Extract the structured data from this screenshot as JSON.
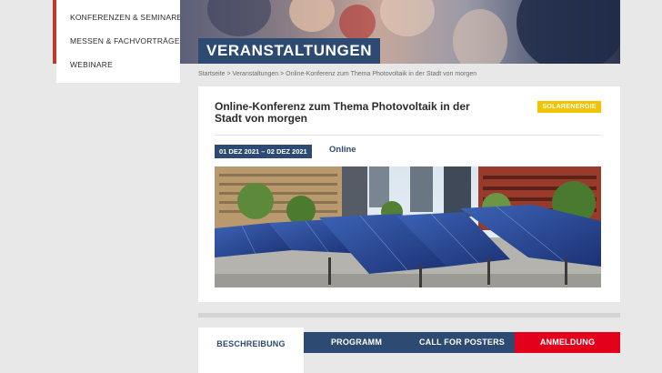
{
  "sidebar": {
    "items": [
      {
        "label": "KONFERENZEN & SEMINARE"
      },
      {
        "label": "MESSEN & FACHVORTRÄGE"
      },
      {
        "label": "WEBINARE"
      }
    ]
  },
  "hero": {
    "title": "VERANSTALTUNGEN"
  },
  "breadcrumb": "Startseite > Veranstaltungen > Online-Konferenz zum Thema Photovoltaik in der Stadt von morgen",
  "event": {
    "title": "Online-Konferenz zum Thema Photovoltaik in der Stadt von morgen",
    "tag": "SOLARENERGIE",
    "date": "01 DEZ 2021 – 02 DEZ 2021",
    "location": "Online"
  },
  "tabs": [
    {
      "label": "BESCHREIBUNG"
    },
    {
      "label": "PROGRAMM"
    },
    {
      "label": "CALL FOR POSTERS"
    },
    {
      "label": "ANMELDUNG"
    }
  ],
  "colors": {
    "brand_blue": "#2c4a72",
    "accent_red": "#e3001b",
    "tag_yellow": "#f4c300"
  }
}
